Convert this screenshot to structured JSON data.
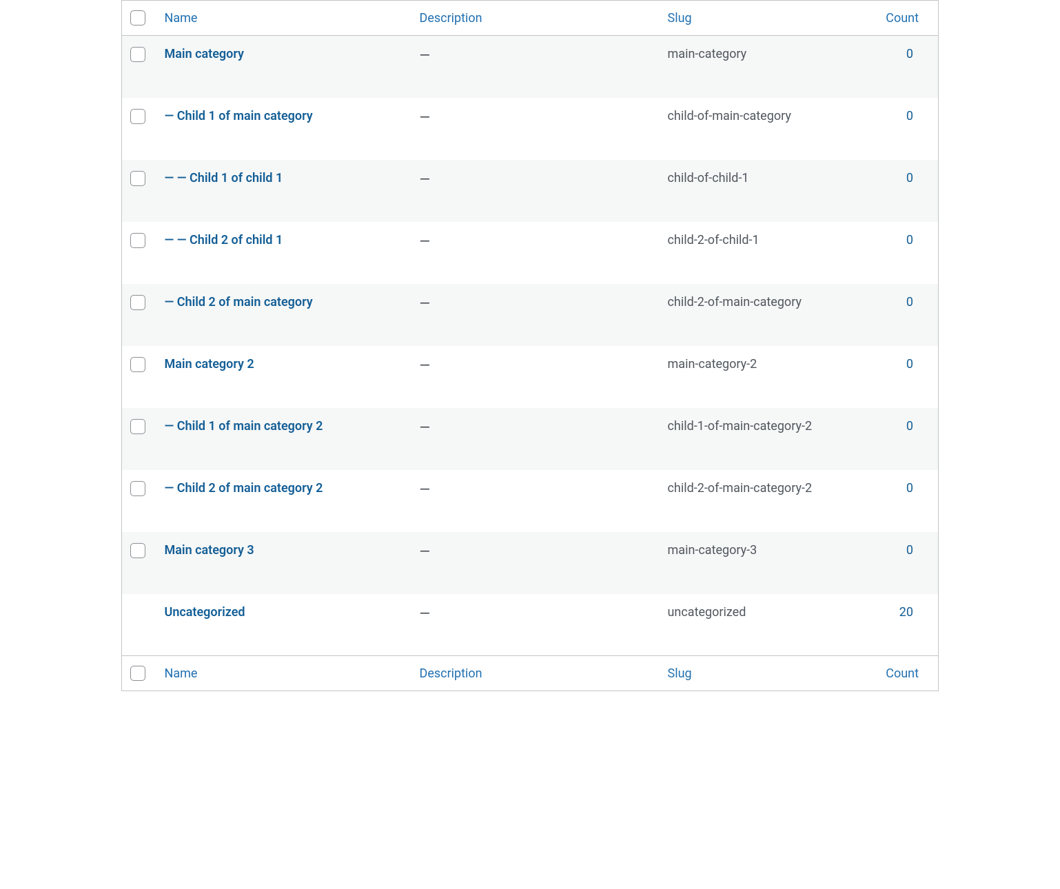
{
  "columns": {
    "name": "Name",
    "description": "Description",
    "slug": "Slug",
    "count": "Count"
  },
  "rows": [
    {
      "hasCheckbox": true,
      "name": "Main category",
      "description": "—",
      "slug": "main-category",
      "count": "0",
      "stripe": true
    },
    {
      "hasCheckbox": true,
      "name": "— Child 1 of main category",
      "description": "—",
      "slug": "child-of-main-category",
      "count": "0",
      "stripe": false
    },
    {
      "hasCheckbox": true,
      "name": "— — Child 1 of child 1",
      "description": "—",
      "slug": "child-of-child-1",
      "count": "0",
      "stripe": true
    },
    {
      "hasCheckbox": true,
      "name": "— — Child 2 of child 1",
      "description": "—",
      "slug": "child-2-of-child-1",
      "count": "0",
      "stripe": false
    },
    {
      "hasCheckbox": true,
      "name": "— Child 2 of main category",
      "description": "—",
      "slug": "child-2-of-main-category",
      "count": "0",
      "stripe": true
    },
    {
      "hasCheckbox": true,
      "name": "Main category 2",
      "description": "—",
      "slug": "main-category-2",
      "count": "0",
      "stripe": false
    },
    {
      "hasCheckbox": true,
      "name": "— Child 1 of main category 2",
      "description": "—",
      "slug": "child-1-of-main-category-2",
      "count": "0",
      "stripe": true
    },
    {
      "hasCheckbox": true,
      "name": "— Child 2 of main category 2",
      "description": "—",
      "slug": "child-2-of-main-category-2",
      "count": "0",
      "stripe": false
    },
    {
      "hasCheckbox": true,
      "name": "Main category 3",
      "description": "—",
      "slug": "main-category-3",
      "count": "0",
      "stripe": true
    },
    {
      "hasCheckbox": false,
      "name": "Uncategorized",
      "description": "—",
      "slug": "uncategorized",
      "count": "20",
      "stripe": false
    }
  ]
}
